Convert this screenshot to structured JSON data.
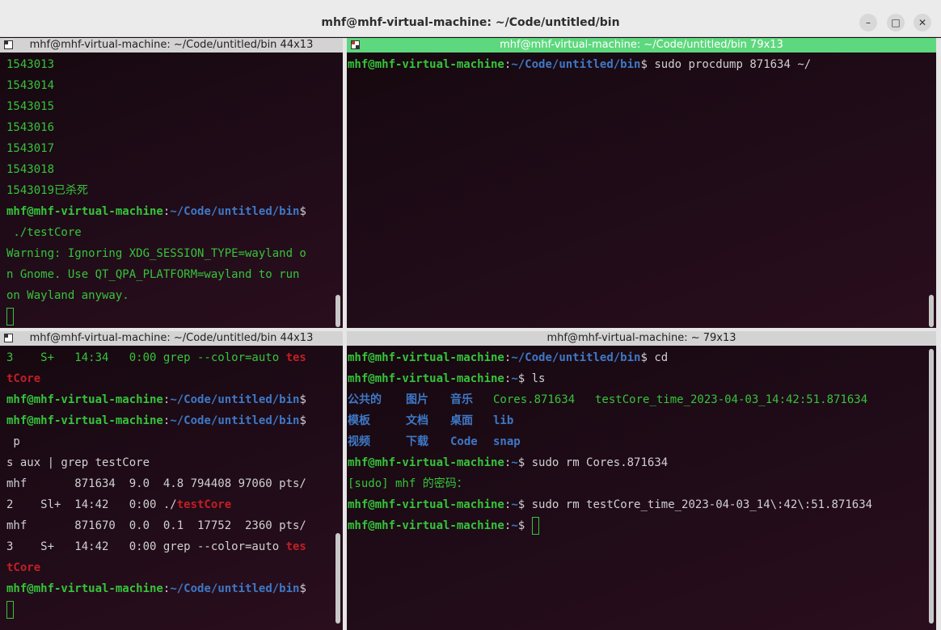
{
  "window": {
    "title": "mhf@mhf-virtual-machine: ~/Code/untitled/bin",
    "minimize": "–",
    "maximize": "□",
    "close": "✕"
  },
  "panes": {
    "top_left": {
      "title": "mhf@mhf-virtual-machine: ~/Code/untitled/bin 44x13",
      "lines": [
        {
          "pid1": "1543013"
        },
        {
          "pid2": "1543014"
        },
        {
          "pid3": "1543015"
        },
        {
          "pid4": "1543016"
        },
        {
          "pid5": "1543017"
        },
        {
          "pid6": "1543018"
        },
        {
          "pid7": "1543019已杀死"
        }
      ],
      "prompt_user": "mhf@mhf-virtual-machine",
      "prompt_sep": ":",
      "prompt_path": "~/Code/untitled/bin",
      "prompt_dollar": "$",
      "cmd": " ./testCore",
      "warn1": "Warning: Ignoring XDG_SESSION_TYPE=wayland o",
      "warn2": "n Gnome. Use QT_QPA_PLATFORM=wayland to run",
      "warn3": "on Wayland anyway."
    },
    "top_right": {
      "title": "mhf@mhf-virtual-machine: ~/Code/untitled/bin 79x13",
      "prompt_user": "mhf@mhf-virtual-machine",
      "prompt_sep": ":",
      "prompt_path": "~/Code/untitled/bin",
      "prompt_dollar": "$",
      "cmd": " sudo procdump 871634 ~/"
    },
    "bottom_left": {
      "title": "mhf@mhf-virtual-machine: ~/Code/untitled/bin 44x13",
      "l1a": "3    S+   14:34   0:00 grep --color=auto ",
      "l1b": "tes",
      "l2": "tCore",
      "prompt_user": "mhf@mhf-virtual-machine",
      "prompt_sep": ":",
      "prompt_path": "~/Code/untitled/bin",
      "prompt_dollar": "$",
      "l5": " p",
      "l6": "s aux | grep testCore",
      "l7": "mhf       871634  9.0  4.8 794408 97060 pts/",
      "l8a": "2    Sl+  14:42   0:00 ./",
      "l8b": "testCore",
      "l9": "mhf       871670  0.0  0.1  17752  2360 pts/",
      "l10a": "3    S+   14:42   0:00 grep --color=auto ",
      "l10b": "tes",
      "l11": "tCore"
    },
    "bottom_right": {
      "title": "mhf@mhf-virtual-machine: ~ 79x13",
      "prompt_user": "mhf@mhf-virtual-machine",
      "prompt_sep": ":",
      "path_bin": "~/Code/untitled/bin",
      "path_home": "~",
      "prompt_dollar": "$",
      "cmd_cd": " cd",
      "cmd_ls": " ls",
      "ls_row1": [
        "公共的",
        "图片",
        "音乐",
        "Cores.871634",
        "testCore_time_2023-04-03_14:42:51.871634"
      ],
      "ls_row2": [
        "模板",
        "文档",
        "桌面",
        "lib"
      ],
      "ls_row3": [
        "视频",
        "下载",
        "Code",
        "snap"
      ],
      "cmd_rm1": " sudo rm Cores.871634",
      "sudo_prompt": "[sudo] mhf 的密码：",
      "cmd_rm2": " sudo rm testCore_time_2023-04-03_14\\:42\\:51.871634"
    }
  },
  "colors": {
    "prompt_user": "#35c43a",
    "prompt_path": "#3e78c6",
    "active_header": "#5ed87e",
    "highlight": "#c21f24"
  }
}
